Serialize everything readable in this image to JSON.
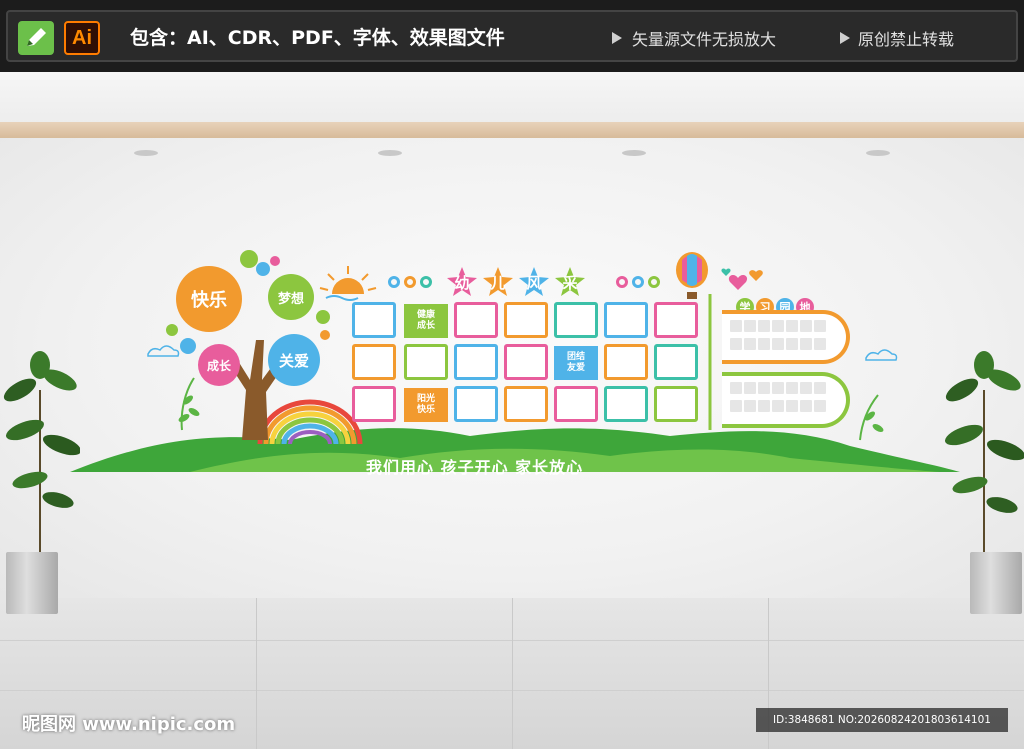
{
  "banner": {
    "pencil_icon": "pencil-icon",
    "ai_label": "Ai",
    "includes_text": "包含：AI、CDR、PDF、字体、效果图文件",
    "note_1": "矢量源文件无损放大",
    "note_2": "原创禁止转载"
  },
  "wall": {
    "title_chars": [
      "幼",
      "儿",
      "风",
      "采"
    ],
    "title_colors": [
      "#e85d9c",
      "#f29a2e",
      "#4fb3e8",
      "#8cc63f"
    ],
    "tree_circles": {
      "happy": "快乐",
      "dream": "梦想",
      "grow": "成长",
      "care": "关爱"
    },
    "photo_labels": {
      "health": "健康\n成长",
      "unity": "团结\n友爱",
      "sunny": "阳光\n快乐"
    },
    "study_area_title": "学习园地",
    "study_chars": [
      "学",
      "习",
      "园",
      "地"
    ],
    "slogan": "我们用心  孩子开心  家长放心"
  },
  "watermark": {
    "site": "昵图网 www.nipic.com",
    "id_text": "ID:3848681 NO:20260824201803614101"
  },
  "colors": {
    "pink": "#e85d9c",
    "orange": "#f29a2e",
    "blue": "#4fb3e8",
    "green": "#8cc63f",
    "teal": "#3cc0a8",
    "hill_green": "#3ea63a"
  }
}
